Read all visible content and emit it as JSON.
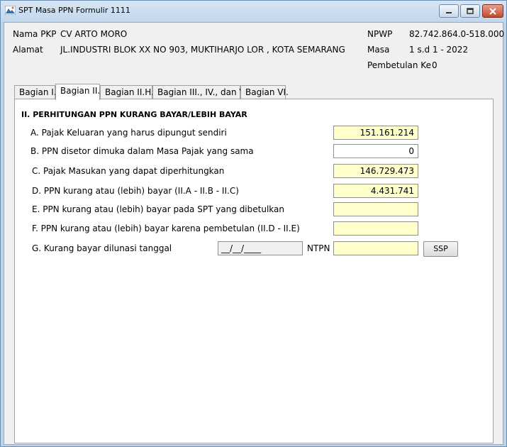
{
  "window": {
    "title": "SPT Masa PPN Formulir 1111"
  },
  "header": {
    "nama_pkp_label": "Nama PKP",
    "nama_pkp_value": "CV ARTO MORO",
    "alamat_label": "Alamat",
    "alamat_value": "JL.INDUSTRI BLOK XX NO 903, MUKTIHARJO LOR , KOTA SEMARANG",
    "npwp_label": "NPWP",
    "npwp_value": "82.742.864.0-518.000",
    "masa_label": "Masa",
    "masa_value": "1 s.d 1 - 2022",
    "pembetulan_label": "Pembetulan Ke",
    "pembetulan_value": "0"
  },
  "tabs": [
    {
      "label": "Bagian I."
    },
    {
      "label": "Bagian II."
    },
    {
      "label": "Bagian II.H."
    },
    {
      "label": "Bagian III., IV., dan V."
    },
    {
      "label": "Bagian VI."
    }
  ],
  "active_tab": "Bagian II.",
  "section": {
    "title": "II. PERHITUNGAN PPN KURANG BAYAR/LEBIH BAYAR",
    "rows": [
      {
        "label": "A. Pajak Keluaran yang harus dipungut sendiri",
        "value": "151.161.214"
      },
      {
        "label": "B. PPN disetor dimuka dalam Masa Pajak yang sama",
        "value": "0"
      },
      {
        "label": "C. Pajak Masukan yang dapat diperhitungkan",
        "value": "146.729.473"
      },
      {
        "label": "D. PPN kurang atau (lebih) bayar (II.A - II.B - II.C)",
        "value": "4.431.741"
      },
      {
        "label": "E. PPN kurang atau (lebih) bayar pada SPT yang dibetulkan",
        "value": ""
      },
      {
        "label": "F. PPN kurang atau (lebih) bayar karena pembetulan (II.D - II.E)",
        "value": ""
      }
    ],
    "g_label": "G. Kurang bayar dilunasi tanggal",
    "g_date": "__/__/____",
    "ntpn_label": "NTPN",
    "ntpn_value": "",
    "ssp_button": "SSP"
  },
  "colors": {
    "readonly_field": "#ffffcc",
    "editable_field": "#ffffff",
    "titlebar": "#c3d7ec",
    "close_button": "#c34a2e"
  },
  "icons": [
    "app-icon",
    "minimize-icon",
    "maximize-icon",
    "close-icon"
  ]
}
